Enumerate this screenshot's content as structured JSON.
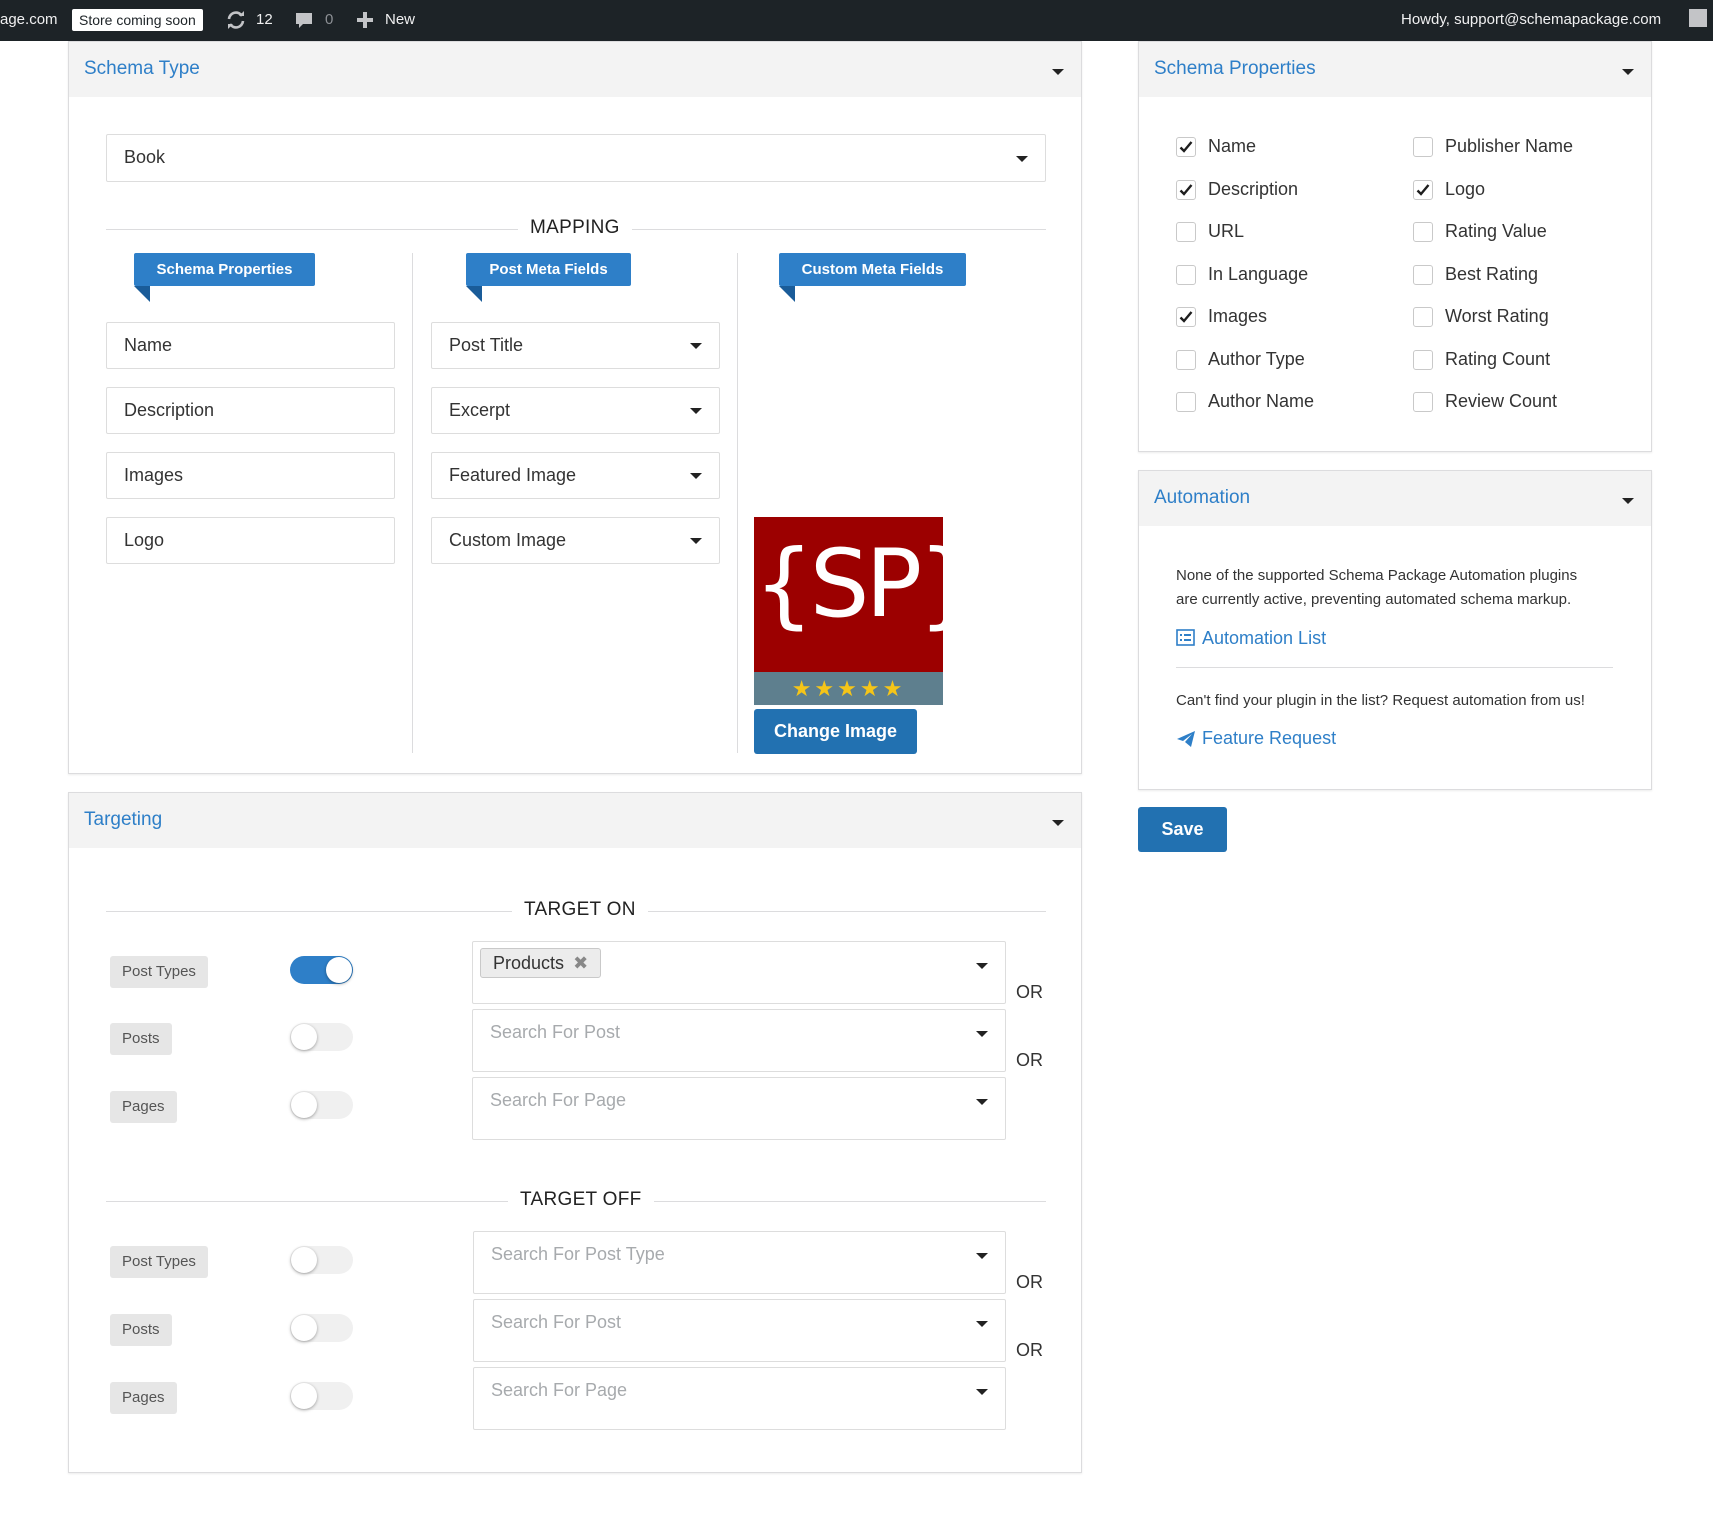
{
  "admin_bar": {
    "site_fragment": "age.com",
    "store_badge": "Store coming soon",
    "updates_count": "12",
    "comments_count": "0",
    "new_label": "New",
    "greeting": "Howdy, support@schemapackage.com"
  },
  "schema_type_panel": {
    "title": "Schema Type",
    "selected_type": "Book",
    "mapping_title": "MAPPING",
    "ribbons": [
      "Schema Properties",
      "Post Meta Fields",
      "Custom Meta Fields"
    ],
    "rows": [
      {
        "property": "Name",
        "meta_field": "Post Title"
      },
      {
        "property": "Description",
        "meta_field": "Excerpt"
      },
      {
        "property": "Images",
        "meta_field": "Featured Image"
      },
      {
        "property": "Logo",
        "meta_field": "Custom Image"
      }
    ],
    "logo_text": "{SP}",
    "logo_stars": "★★★★★",
    "change_image_label": "Change Image"
  },
  "targeting_panel": {
    "title": "Targeting",
    "target_on_title": "TARGET ON",
    "target_off_title": "TARGET OFF",
    "or_label": "OR",
    "target_on": [
      {
        "label": "Post Types",
        "enabled": true,
        "chip": "Products",
        "placeholder": ""
      },
      {
        "label": "Posts",
        "enabled": false,
        "chip": "",
        "placeholder": "Search For Post"
      },
      {
        "label": "Pages",
        "enabled": false,
        "chip": "",
        "placeholder": "Search For Page"
      }
    ],
    "target_off": [
      {
        "label": "Post Types",
        "enabled": false,
        "placeholder": "Search For Post Type"
      },
      {
        "label": "Posts",
        "enabled": false,
        "placeholder": "Search For Post"
      },
      {
        "label": "Pages",
        "enabled": false,
        "placeholder": "Search For Page"
      }
    ]
  },
  "schema_properties_panel": {
    "title": "Schema Properties",
    "left": [
      {
        "label": "Name",
        "checked": true
      },
      {
        "label": "Description",
        "checked": true
      },
      {
        "label": "URL",
        "checked": false
      },
      {
        "label": "In Language",
        "checked": false
      },
      {
        "label": "Images",
        "checked": true
      },
      {
        "label": "Author Type",
        "checked": false
      },
      {
        "label": "Author Name",
        "checked": false
      }
    ],
    "right": [
      {
        "label": "Publisher Name",
        "checked": false
      },
      {
        "label": "Logo",
        "checked": true
      },
      {
        "label": "Rating Value",
        "checked": false
      },
      {
        "label": "Best Rating",
        "checked": false
      },
      {
        "label": "Worst Rating",
        "checked": false
      },
      {
        "label": "Rating Count",
        "checked": false
      },
      {
        "label": "Review Count",
        "checked": false
      }
    ]
  },
  "automation_panel": {
    "title": "Automation",
    "message_line1": "None of the supported Schema Package Automation plugins",
    "message_line2": "are currently active, preventing automated schema markup.",
    "automation_list_label": "Automation List",
    "request_text": "Can't find your plugin in the list? Request automation from us!",
    "feature_request_label": "Feature Request"
  },
  "save_label": "Save",
  "colors": {
    "accent": "#2e7fc8",
    "button": "#2271b1",
    "admin_bar": "#1d2327",
    "logo_red": "#9c0000",
    "logo_band": "#5e7f8e",
    "star": "#f5c518"
  }
}
